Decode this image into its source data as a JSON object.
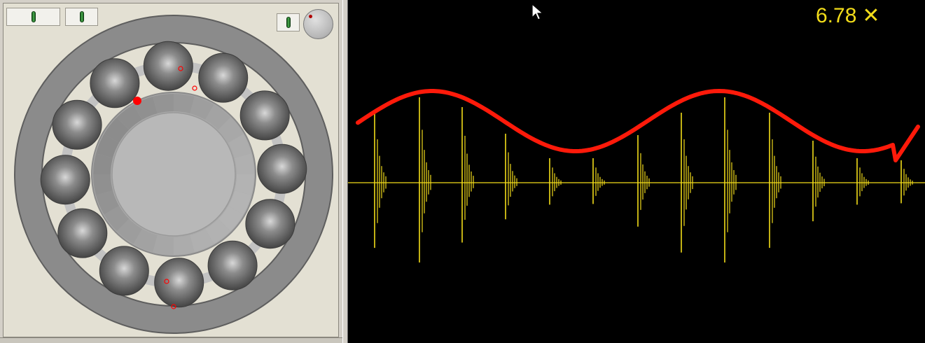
{
  "left_panel": {
    "buttons": [
      "knob-toggle-1",
      "knob-toggle-2",
      "knob-toggle-3"
    ]
  },
  "oscilloscope": {
    "speed_value": "6.78",
    "speed_symbol": "✕",
    "colors": {
      "background": "#000000",
      "waveform": "#f2dc1a",
      "envelope": "#ff1a0a"
    }
  },
  "bearing": {
    "ball_count": 12,
    "colors": {
      "outer_ring": "#8a8a8a",
      "inner_ring": "#a8a8a8",
      "ball": "#5a5a5a",
      "marker": "#ff0000"
    }
  }
}
